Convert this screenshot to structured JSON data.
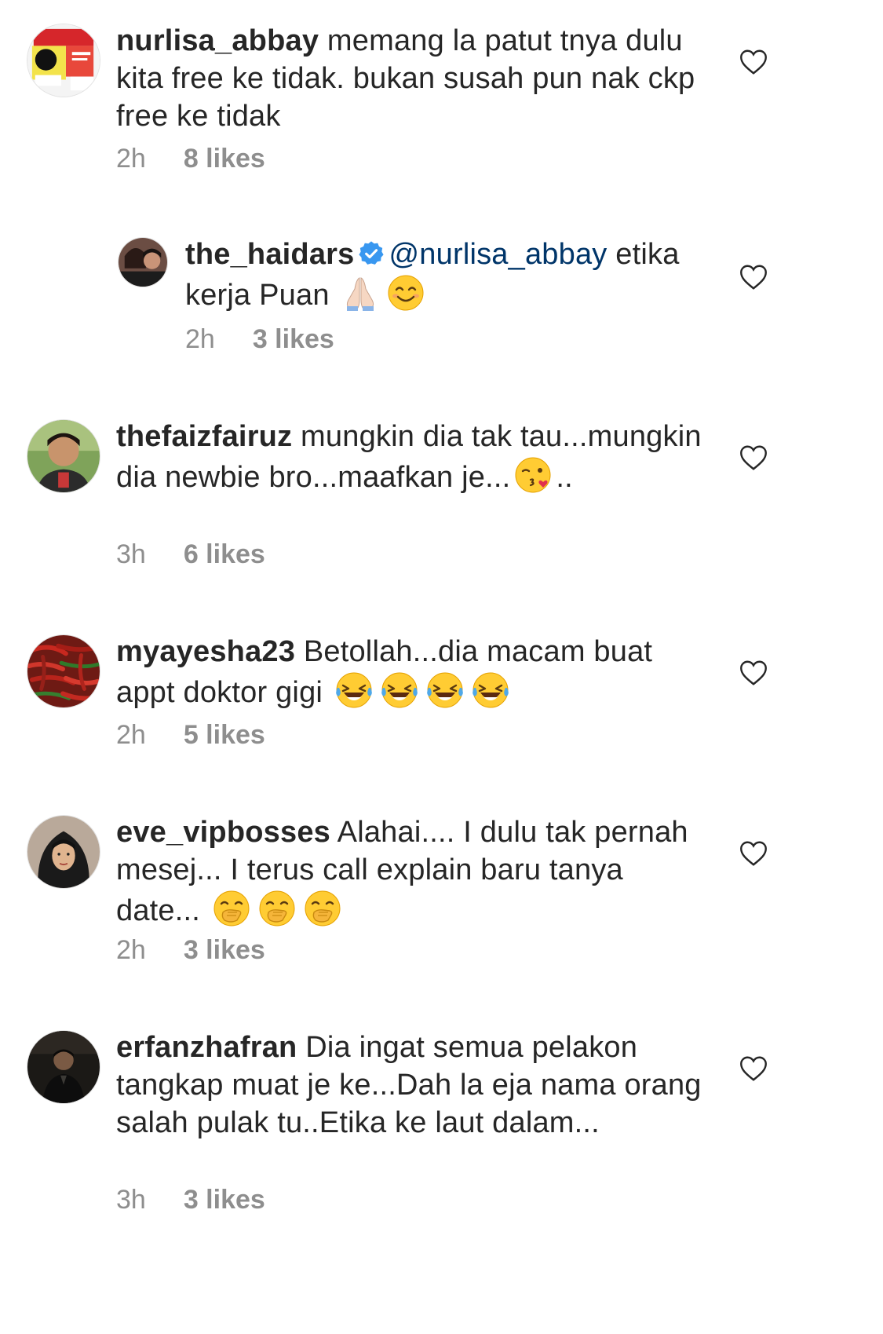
{
  "comments": [
    {
      "username": "nurlisa_abbay",
      "text": " memang la patut tnya dulu kita free ke tidak. bukan susah pun nak ckp free ke tidak",
      "time": "2h",
      "likes": "8 likes",
      "avatar": "avatar-poster"
    },
    {
      "username": "the_haidars",
      "mention": "@nurlisa_abbay",
      "text": " etika kerja Puan ",
      "emojis": [
        "folded-hands-emoji",
        "smiling-face-emoji"
      ],
      "time": "2h",
      "likes": "3 likes",
      "verified": true,
      "avatar": "avatar-couple"
    },
    {
      "username": "thefaizfairuz",
      "text_a": " mungkin dia tak tau...mungkin dia newbie bro...maafkan je...",
      "text_b": "..",
      "emojis": [
        "face-blowing-kiss-emoji"
      ],
      "time": "3h",
      "likes": "6 likes",
      "avatar": "avatar-man"
    },
    {
      "username": "myayesha23",
      "text": " Betollah...dia macam buat appt doktor gigi ",
      "emojis": [
        "tears-of-joy-emoji",
        "tears-of-joy-emoji",
        "tears-of-joy-emoji",
        "tears-of-joy-emoji"
      ],
      "time": "2h",
      "likes": "5 likes",
      "avatar": "avatar-chilies"
    },
    {
      "username": "eve_vipbosses",
      "text": " Alahai.... I dulu tak pernah mesej... I terus call explain baru tanya date... ",
      "emojis": [
        "hand-over-mouth-emoji",
        "hand-over-mouth-emoji",
        "hand-over-mouth-emoji"
      ],
      "time": "2h",
      "likes": "3 likes",
      "avatar": "avatar-hijab"
    },
    {
      "username": "erfanzhafran",
      "text": " Dia ingat semua pelakon tangkap muat je ke...Dah la eja nama orang salah pulak tu..Etika ke laut dalam...",
      "time": "3h",
      "likes": "3 likes",
      "avatar": "avatar-dark"
    }
  ],
  "colors": {
    "text": "#262626",
    "meta": "#8e8e8e",
    "mention": "#003569",
    "verified": "#3897f0"
  },
  "icons": {
    "like": "heart-outline-icon",
    "verified": "verified-badge-icon"
  }
}
